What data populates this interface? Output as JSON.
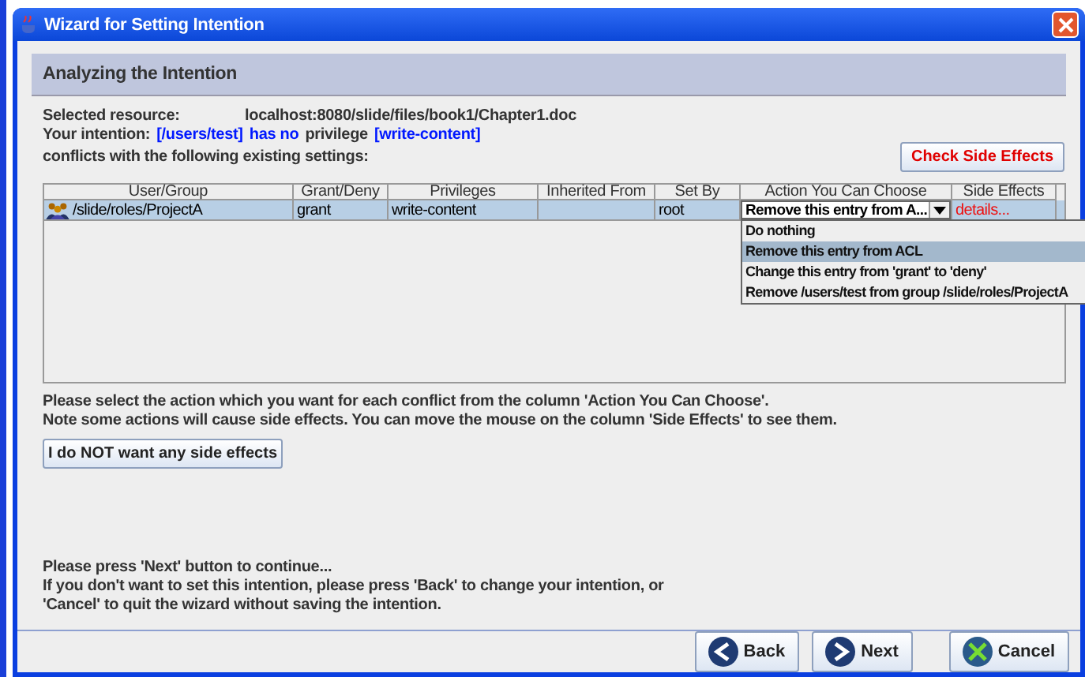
{
  "window": {
    "title": "Wizard for Setting Intention"
  },
  "header": {
    "title": "Analyzing the Intention"
  },
  "resource": {
    "label": "Selected resource:",
    "value": "localhost:8080/slide/files/book1/Chapter1.doc"
  },
  "intention": [
    {
      "kind": "plain",
      "text": "Your intention:"
    },
    {
      "kind": "value",
      "text": "[/users/test]"
    },
    {
      "kind": "value",
      "text": "has no"
    },
    {
      "kind": "plain",
      "text": "privilege"
    },
    {
      "kind": "value",
      "text": "[write-content]"
    }
  ],
  "conflicts_text": "conflicts with the following existing settings:",
  "check_button": "Check Side Effects",
  "table": {
    "columns": [
      "User/Group",
      "Grant/Deny",
      "Privileges",
      "Inherited From",
      "Set By",
      "Action You Can Choose",
      "Side Effects"
    ],
    "rows": [
      {
        "user_group": "/slide/roles/ProjectA",
        "grant_deny": "grant",
        "privileges": "write-content",
        "inherited_from": "",
        "set_by": "root",
        "action": "Remove this entry from A...",
        "side_effects": "details...",
        "selected": true
      }
    ]
  },
  "action_dropdown": {
    "expanded": true,
    "options": [
      {
        "label": "Do nothing",
        "selected": false
      },
      {
        "label": "Remove this entry from ACL",
        "selected": true
      },
      {
        "label": "Change this entry from 'grant' to 'deny'",
        "selected": false
      },
      {
        "label": "Remove /users/test from group /slide/roles/ProjectA",
        "selected": false
      }
    ]
  },
  "instructions": [
    "Please select the action which you want for each conflict from the column 'Action You Can Choose'.",
    "Note some actions will cause side effects. You can move the mouse on the column 'Side Effects' to see them."
  ],
  "no_side_effects_button": "I do NOT want any side effects",
  "footer_text": [
    "Please press 'Next' button to continue...",
    "If you don't want to set this intention, please press 'Back' to change your intention, or",
    "'Cancel' to quit the wizard without saving the intention."
  ],
  "buttons": [
    {
      "kind": "back",
      "label": "Back"
    },
    {
      "kind": "next",
      "label": "Next"
    },
    {
      "kind": "cancel",
      "label": "Cancel"
    }
  ]
}
